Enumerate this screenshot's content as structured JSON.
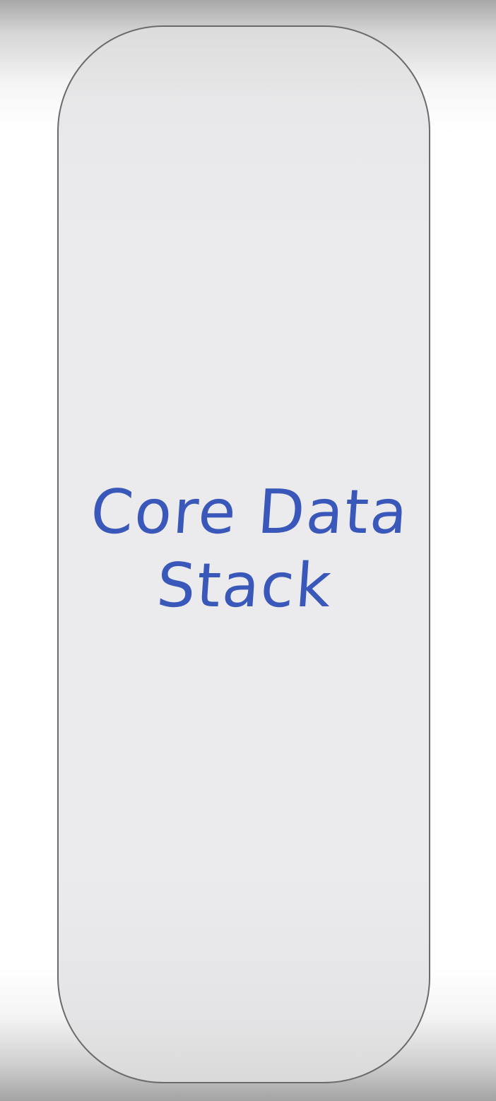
{
  "diagram": {
    "box": {
      "label_lines": [
        "Core Data",
        "Stack"
      ]
    }
  },
  "colors": {
    "label": "#3a58b9",
    "box_fill": "#ebebed",
    "box_border": "#6b6b6b"
  }
}
